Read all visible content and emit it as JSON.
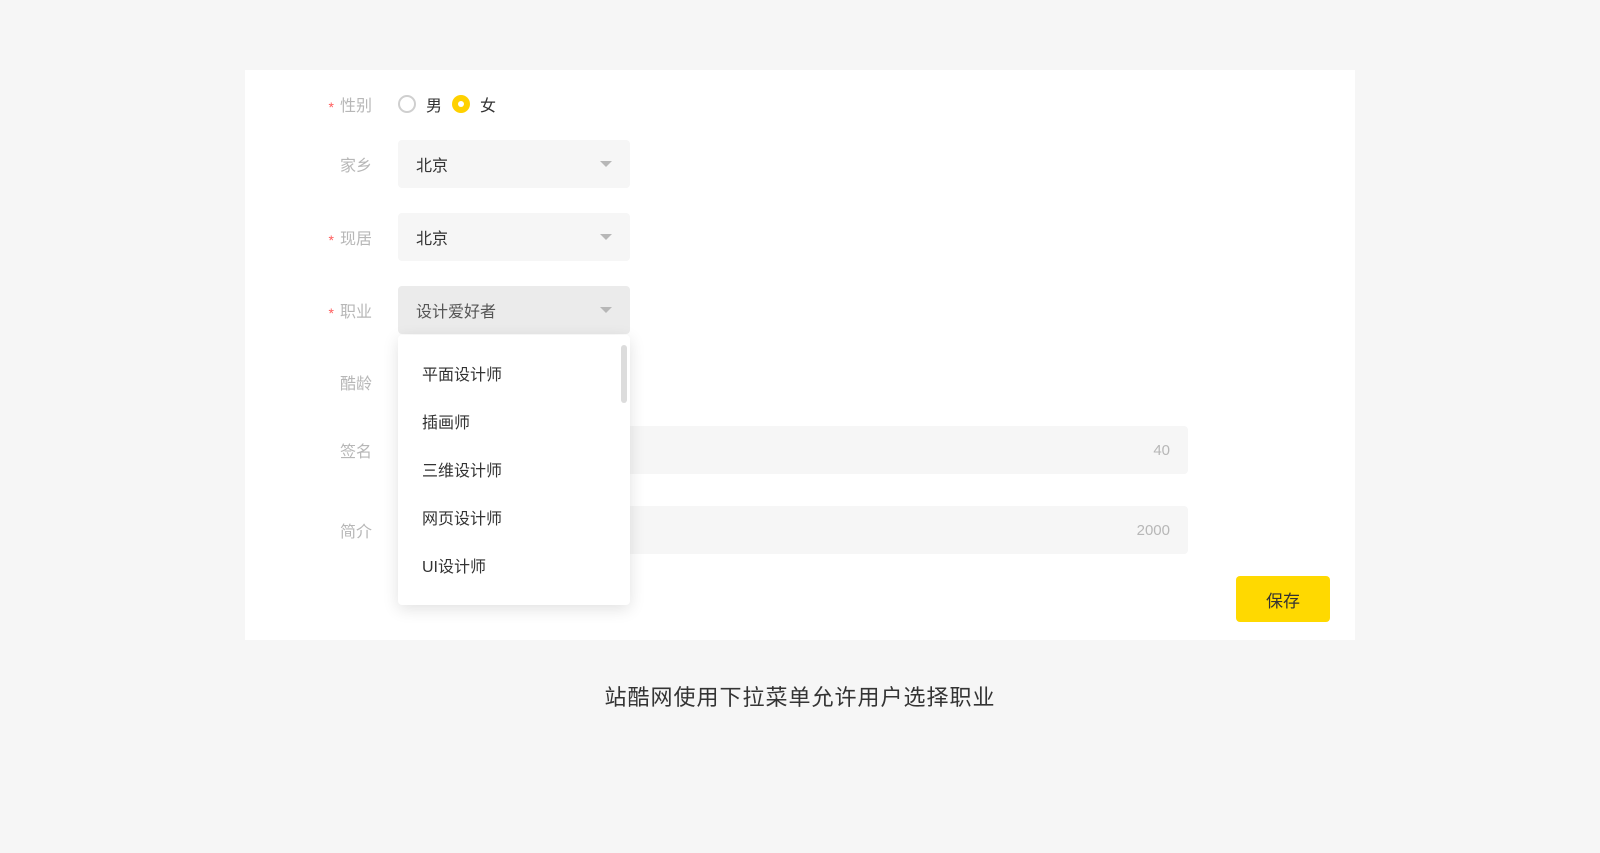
{
  "fields": {
    "gender": {
      "label": "性别",
      "required": true,
      "options": [
        {
          "label": "男",
          "selected": false
        },
        {
          "label": "女",
          "selected": true
        }
      ]
    },
    "hometown": {
      "label": "家乡",
      "required": false,
      "value": "北京"
    },
    "residence": {
      "label": "现居",
      "required": true,
      "value": "北京"
    },
    "profession": {
      "label": "职业",
      "required": true,
      "value": "设计爱好者"
    },
    "age": {
      "label": "酷龄",
      "required": false
    },
    "signature": {
      "label": "签名",
      "required": false,
      "counter": "40"
    },
    "intro": {
      "label": "简介",
      "required": false,
      "counter": "2000"
    }
  },
  "profession_options": [
    "平面设计师",
    "插画师",
    "三维设计师",
    "网页设计师",
    "UI设计师"
  ],
  "save_label": "保存",
  "caption": "站酷网使用下拉菜单允许用户选择职业"
}
